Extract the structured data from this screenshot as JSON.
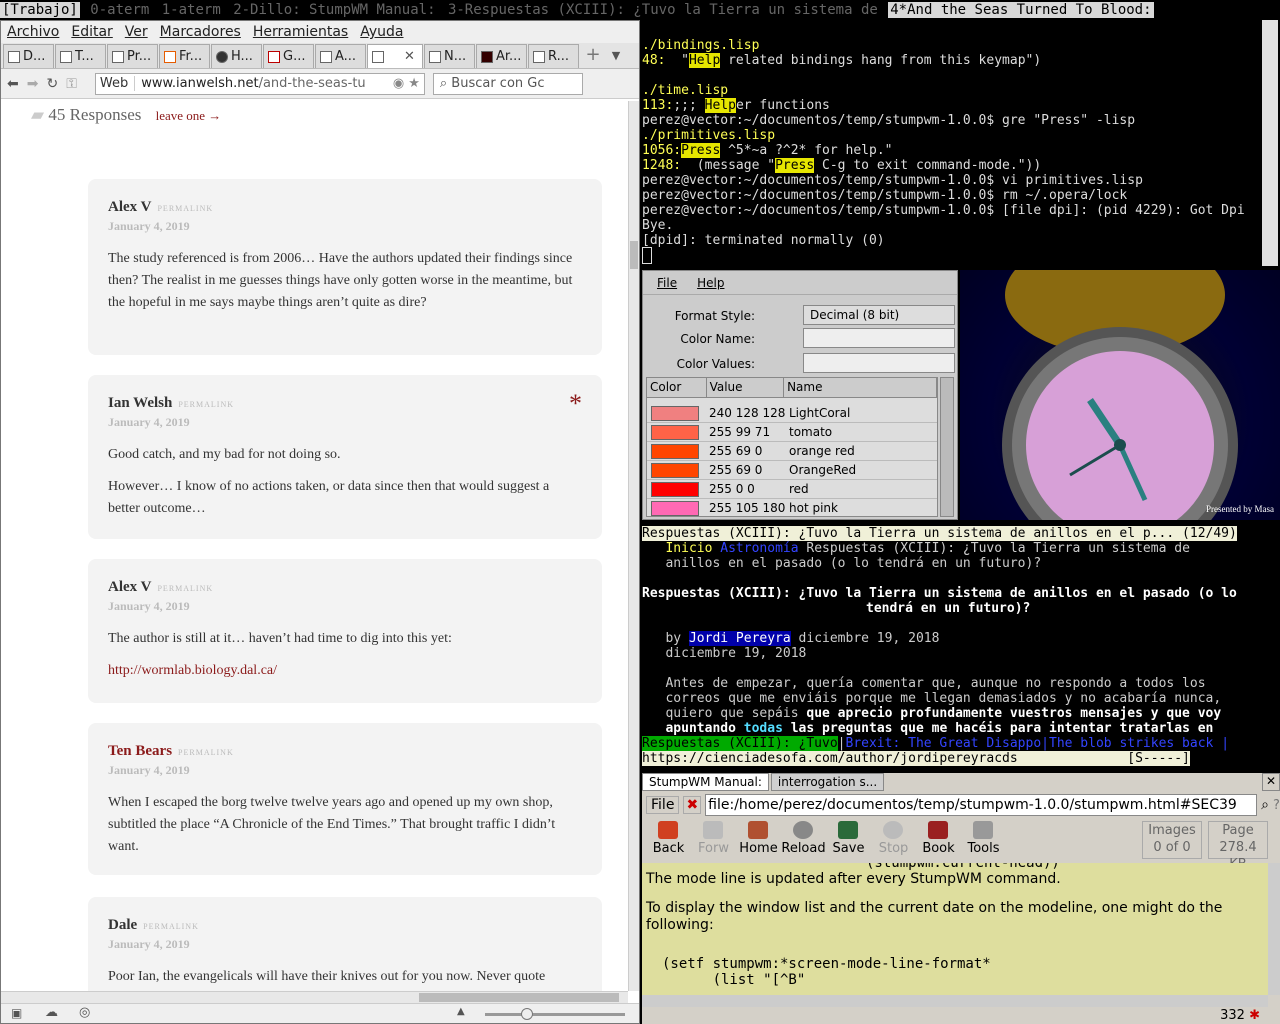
{
  "modeline": {
    "group": "[Trabajo]",
    "w0": "0-aterm",
    "w1": "1-aterm",
    "w2": "2-Dillo: StumpWM Manual:",
    "w3": "3-Respuestas (XCIII): ¿Tuvo la Tierra un sistema de",
    "w4": "4*And the Seas Turned To Blood:"
  },
  "browser": {
    "menu": [
      "Archivo",
      "Editar",
      "Ver",
      "Marcadores",
      "Herramientas",
      "Ayuda"
    ],
    "tabs": [
      "D...",
      "T...",
      "Pr...",
      "Fr...",
      "H...",
      "G...",
      "A...",
      "",
      "N...",
      "Ar...",
      "R..."
    ],
    "url_label": "Web",
    "url_host": "www.ianwelsh.net",
    "url_path": "/and-the-seas-tu",
    "search_placeholder": "Buscar con Gc",
    "responses_title": "45 Responses",
    "leave": "leave one →",
    "perma": "PERMALINK",
    "comments": [
      {
        "author": "Alex V",
        "date": "January 4, 2019",
        "p1": "The study referenced is from 2006… Have the authors updated their findings since then? The realist in me guesses things have only gotten worse in the meantime, but the hopeful in me says maybe things aren’t quite as dire?"
      },
      {
        "author": "Ian Welsh",
        "date": "January 4, 2019",
        "p1": "Good catch, and my bad for not doing so.",
        "p2": "However… I know of no actions taken, or data since then that would suggest a better outcome…",
        "star": "*"
      },
      {
        "author": "Alex V",
        "date": "January 4, 2019",
        "p1": "The author is still at it… haven’t had time to dig into this yet:",
        "link": "http://wormlab.biology.dal.ca/"
      },
      {
        "author": "Ten Bears",
        "date": "January 4, 2019",
        "p1": "When I escaped the borg twelve twelve years ago and opened up my own shop, subtitled the place “A Chronicle of the End Times.” That brought traffic I didn’t want."
      },
      {
        "author": "Dale",
        "date": "January 4, 2019",
        "p1": "Poor Ian, the evangelicals will have their knives out for you now. Never quote scripture to those who profess to believe but only cherry pick what"
      }
    ]
  },
  "term1": {
    "l1": "./bindings.lisp",
    "l2a": "48:",
    "l2b": "  \"",
    "l2c": "Help",
    "l2d": " related bindings hang from this keymap\")",
    "l3": "./time.lisp",
    "l4a": "113:",
    ";": "",
    "l4b": ";;; ",
    "l4c": "Help",
    "l4d": "er functions",
    "l5": "perez@vector:~/documentos/temp/stumpwm-1.0.0$ gre \"Press\" -lisp",
    "l6": "./primitives.lisp",
    "l7a": "1056:",
    "l7b": "Press",
    "l7c": " ^5*~a ?^2* for help.\"",
    "l8a": "1248:",
    "l8b": "  (message \"",
    "l8c": "Press",
    "l8d": " C-g to exit command-mode.\"))",
    "l9": "perez@vector:~/documentos/temp/stumpwm-1.0.0$ vi primitives.lisp",
    "l10": "perez@vector:~/documentos/temp/stumpwm-1.0.0$ rm ~/.opera/lock",
    "l11": "perez@vector:~/documentos/temp/stumpwm-1.0.0$ [file dpi]: (pid 4229): Got Dpi",
    "l12": "Bye.",
    "l13": "[dpid]: terminated normally (0)"
  },
  "colorapp": {
    "menu": [
      "File",
      "Help"
    ],
    "format_label": "Format Style:",
    "format_value": "Decimal (8 bit)",
    "name_label": "Color Name:",
    "values_label": "Color Values:",
    "headers": [
      "Color",
      "Value",
      "Name"
    ],
    "rows": [
      {
        "value": "240 128 128",
        "name": "LightCoral",
        "color": "#f08080"
      },
      {
        "value": "255 99 71",
        "name": "tomato",
        "color": "#ff6347"
      },
      {
        "value": "255 69 0",
        "name": "orange red",
        "color": "#ff4500"
      },
      {
        "value": "255 69 0",
        "name": "OrangeRed",
        "color": "#ff4500"
      },
      {
        "value": "255 0 0",
        "name": "red",
        "color": "#ff0000"
      },
      {
        "value": "255 105 180",
        "name": "hot pink",
        "color": "#ff69b4"
      }
    ]
  },
  "clock": {
    "credit": "Presented by Masa"
  },
  "term2": {
    "title": "Respuestas (XCIII): ¿Tuvo la Tierra un sistema de anillos en el p... (12/49)",
    "crumb1": "Inicio",
    "crumb2": "Astronomía",
    "crumb3": "Respuestas (XCIII): ¿Tuvo la Tierra un sistema de",
    "crumb4": "anillos en el pasado (o lo tendrá en un futuro)?",
    "h1": "Respuestas (XCIII): ¿Tuvo la Tierra un sistema de anillos en el pasado (o lo",
    "h2": "tendrá en un futuro)?",
    "by": "by ",
    "author": "Jordi Pereyra",
    "date1": " diciembre 19, 2018",
    "date2": "diciembre 19, 2018",
    "b1": "Antes de empezar, quería comentar que, aunque no respondo a todos los",
    "b2": "correos que me enviáis porque me llegan demasiados y no acabaría nunca,",
    "b3a": "quiero que sepáis ",
    "b3b": "que aprecio profundamente vuestros mensajes y que voy",
    "b4a": "apuntando ",
    "b4b": "todas",
    "b4c": " las preguntas que me hacéis para intentar tratarlas en",
    "tab1": "Respuestas (XCIII): ¿Tuvo",
    "tab2": "Brexit: The Great Disappo",
    "tab3": "The blob strikes back",
    "status_url": "https://cienciadesofa.com/author/jordipereyracds",
    "status_flag": "[S-----]"
  },
  "dillo": {
    "tabs": [
      "StumpWM Manual:",
      "interrogation s..."
    ],
    "file": "File",
    "url": "file:/home/perez/documentos/temp/stumpwm-1.0.0/stumpwm.html#SEC39",
    "tools": [
      "Back",
      "Forw",
      "Home",
      "Reload",
      "Save",
      "Stop",
      "Book",
      "Tools"
    ],
    "images_label": "Images",
    "images_value": "0 of 0",
    "page_label": "Page",
    "page_value": "278.4 KB",
    "top_code": "(stumpwm:current-head))",
    "p1": "The mode line is updated after every StumpWM command.",
    "p2": "To display the window list and the current date on the modeline, one might do the following:",
    "code": "(setf stumpwm:*screen-mode-line-format*",
    "code2": "      (list \"[^B\"",
    "status": "332"
  }
}
